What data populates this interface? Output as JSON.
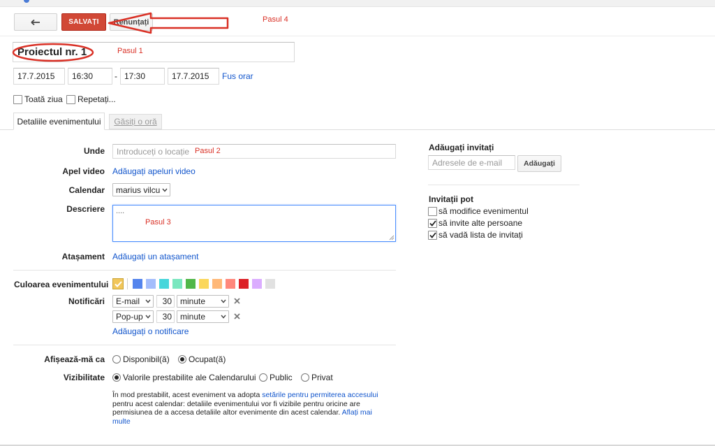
{
  "toolbar": {
    "save_label": "SALVAȚI",
    "discard_label": "Renunțați"
  },
  "annotations": {
    "step1": "Pasul 1",
    "step2": "Pasul 2",
    "step3": "Pasul 3",
    "step4": "Pasul 4"
  },
  "event": {
    "title": "Proiectul nr. 1",
    "start_date": "17.7.2015",
    "start_time": "16:30",
    "dash": "-",
    "end_time": "17:30",
    "end_date": "17.7.2015",
    "timezone_link": "Fus orar",
    "all_day_label": "Toată ziua",
    "repeat_label": "Repetați..."
  },
  "tabs": {
    "details": "Detaliile evenimentului",
    "find_time": "Găsiți o oră"
  },
  "form": {
    "where_label": "Unde",
    "where_placeholder": "Introduceți o locație",
    "video_label": "Apel video",
    "video_link": "Adăugați apeluri video",
    "calendar_label": "Calendar",
    "calendar_value": "marius vilcu",
    "description_label": "Descriere",
    "description_value": "....",
    "attachment_label": "Atașament",
    "attachment_link": "Adăugați un atașament",
    "color_label": "Culoarea evenimentului",
    "notifications_label": "Notificări",
    "notifications": [
      {
        "method": "E-mail",
        "amount": "30",
        "unit": "minute"
      },
      {
        "method": "Pop-up",
        "amount": "30",
        "unit": "minute"
      }
    ],
    "add_notification_link": "Adăugați o notificare",
    "show_me_as_label": "Afișează-mă ca",
    "show_me_as_options": [
      "Disponibil(ă)",
      "Ocupat(ă)"
    ],
    "show_me_as_selected": "Ocupat(ă)",
    "visibility_label": "Vizibilitate",
    "visibility_options": [
      "Valorile prestabilite ale Calendarului",
      "Public",
      "Privat"
    ],
    "visibility_selected": "Valorile prestabilite ale Calendarului",
    "help_text_1": "În mod prestabilit, acest eveniment va adopta ",
    "help_link_1": "setările pentru permiterea accesului",
    "help_text_2": " pentru acest calendar: detaliile evenimentului vor fi vizibile pentru oricine are permisiunea de a accesa detaliile altor evenimente din acest calendar.",
    "help_link_2": "Aflați mai multe"
  },
  "colors": [
    "#5484ed",
    "#a4bdfc",
    "#46d6db",
    "#7ae7bf",
    "#51b749",
    "#fbd75b",
    "#ffb878",
    "#ff887c",
    "#dc2127",
    "#dbadff",
    "#e1e1e1"
  ],
  "default_color": "#f1c65a",
  "guests": {
    "title": "Adăugați invitați",
    "email_placeholder": "Adresele de e-mail",
    "add_button": "Adăugați",
    "permissions_title": "Invitații pot",
    "permissions": [
      {
        "label": "să modifice evenimentul",
        "checked": false
      },
      {
        "label": "să invite alte persoane",
        "checked": true
      },
      {
        "label": "să vadă lista de invitați",
        "checked": true
      }
    ]
  },
  "icons": {
    "back": "back-arrow-icon",
    "remove_notification": "close-icon",
    "checkmark": "checkmark-icon",
    "resize": "resize-handle-icon"
  }
}
